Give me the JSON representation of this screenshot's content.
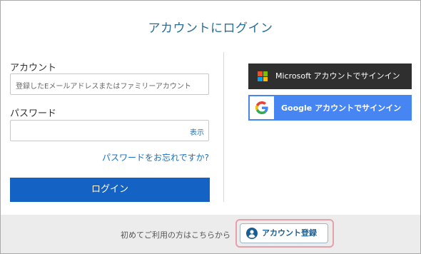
{
  "dialog": {
    "title": "アカウントにログイン"
  },
  "login_form": {
    "account_label": "アカウント",
    "account_placeholder": "登録したEメールアドレスまたはファミリーアカウント",
    "password_label": "パスワード",
    "password_value": "",
    "show_password_label": "表示",
    "forgot_password_link": "パスワードをお忘れですか?",
    "login_button_label": "ログイン"
  },
  "social_login": {
    "microsoft_label": "Microsoft アカウントでサインイン",
    "google_label": "Google アカウントでサインイン",
    "microsoft_logo_colors": [
      "#f25022",
      "#7fba00",
      "#00a4ef",
      "#ffb900"
    ],
    "google_icon": "google-g-icon"
  },
  "footer": {
    "first_time_text": "初めてご利用の方はこちらから",
    "register_button_label": "アカウント登録",
    "register_icon": "user-circle-icon"
  },
  "colors": {
    "title": "#2a6f97",
    "primary_button": "#1462c4",
    "link": "#1a6fc0",
    "microsoft_button": "#2f2f2f",
    "google_button": "#4786f2",
    "register_highlight": "#e5a0aa"
  }
}
